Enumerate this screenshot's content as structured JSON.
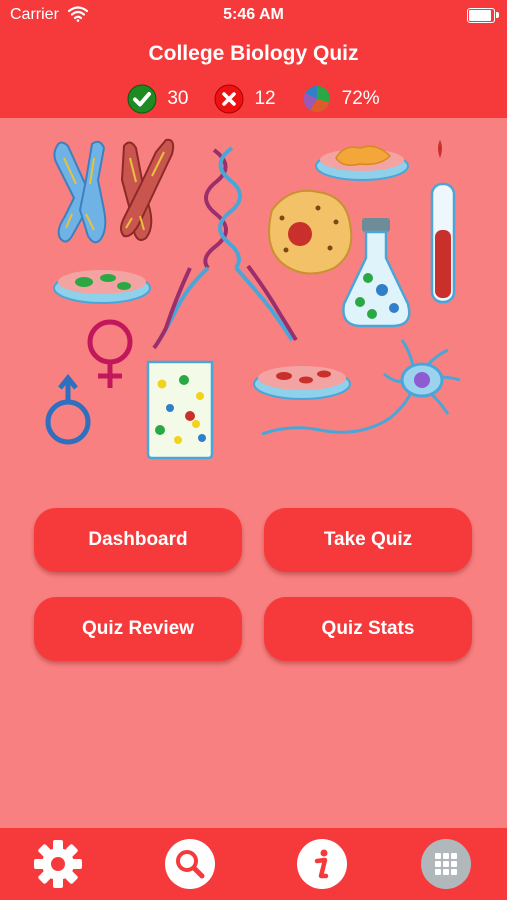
{
  "status_bar": {
    "carrier": "Carrier",
    "time": "5:46 AM"
  },
  "header": {
    "title": "College Biology Quiz"
  },
  "stats": {
    "correct": "30",
    "incorrect": "12",
    "percent": "72%"
  },
  "menu": {
    "dashboard": "Dashboard",
    "take_quiz": "Take Quiz",
    "quiz_review": "Quiz Review",
    "quiz_stats": "Quiz Stats"
  },
  "tab_bar": {
    "icons": [
      "gear-icon",
      "search-icon",
      "info-icon",
      "grid-icon"
    ]
  },
  "colors": {
    "primary": "#f6393b",
    "background": "#f98080",
    "correct": "#1e8a22",
    "incorrect": "#ee1111"
  }
}
